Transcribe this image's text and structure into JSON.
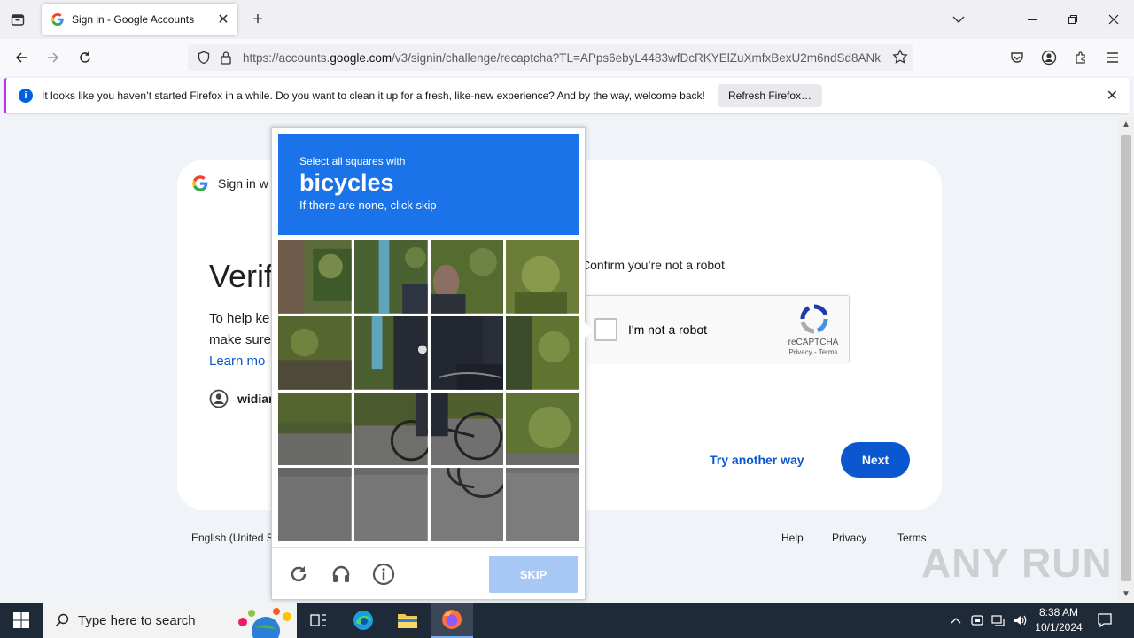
{
  "browser": {
    "tab_title": "Sign in - Google Accounts",
    "url_prefix": "https://accounts.",
    "url_domain": "google.com",
    "url_rest": "/v3/signin/challenge/recaptcha?TL=APps6ebyL4483wfDcRKYElZuXmfxBexU2m6ndSd8ANk",
    "notification": "It looks like you haven’t started Firefox in a while. Do you want to clean it up for a fresh, like-new experience? And by the way, welcome back!",
    "notification_button": "Refresh Firefox…"
  },
  "page": {
    "header_text": "Sign in w",
    "heading": "Verif",
    "desc_line1": "To help ke",
    "desc_line2": "make sure",
    "learn_more": "Learn mo",
    "account_name": "widiar",
    "confirm_text": "Confirm you’re not a robot",
    "recaptcha_label": "I'm not a robot",
    "recaptcha_brand": "reCAPTCHA",
    "recaptcha_links": "Privacy - Terms",
    "try_another": "Try another way",
    "next": "Next",
    "footer_lang": "English (United S",
    "footer_help": "Help",
    "footer_privacy": "Privacy",
    "footer_terms": "Terms"
  },
  "challenge": {
    "line1": "Select all squares with",
    "keyword": "bicycles",
    "line3": "If there are none, click skip",
    "skip": "SKIP"
  },
  "watermark": "ANY RUN",
  "taskbar": {
    "search_placeholder": "Type here to search",
    "time": "8:38 AM",
    "date": "10/1/2024"
  },
  "colors": {
    "google_blue": "#0b57d0",
    "captcha_blue": "#1a73e8",
    "firefox_accent": "#b833e1"
  }
}
